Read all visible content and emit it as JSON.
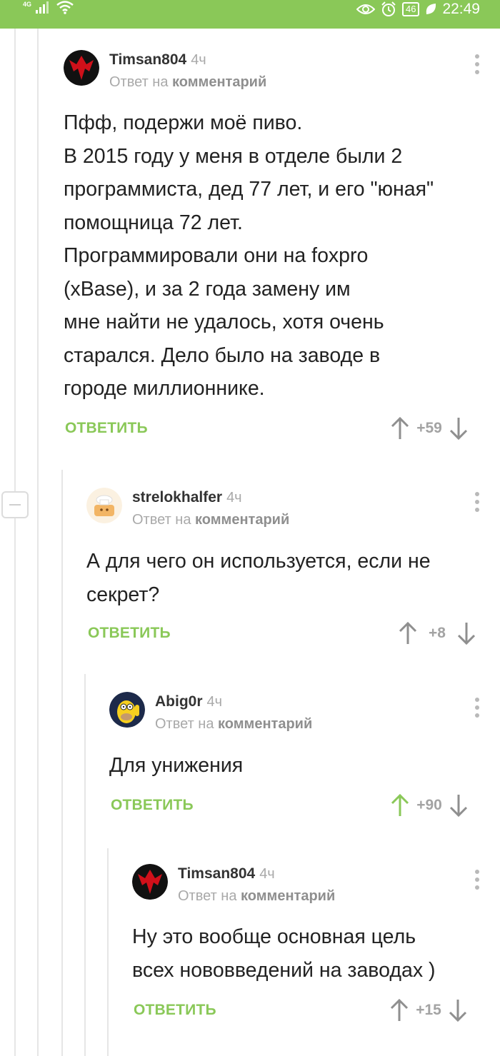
{
  "status_bar": {
    "network": "4G",
    "time": "22:49",
    "battery": "46",
    "icons": [
      "signal-icon",
      "wifi-icon",
      "eye-icon",
      "alarm-icon",
      "battery-icon",
      "leaf-icon"
    ]
  },
  "collapse_button": {
    "icon": "minus-icon"
  },
  "comments": [
    {
      "username": "Timsan804",
      "time": "4ч",
      "reply_prefix": "Ответ на",
      "reply_link": "комментарий",
      "text": "Пфф, подержи моё пиво.\nВ 2015 году у меня в отделе были 2\nпрограммиста, дед 77 лет, и его \"юная\"\nпомощница 72 лет.\nПрограммировали они на foxpro\n(xBase), и за 2 года замену им\nмне найти не удалось, хотя очень\nстарался. Дело было на заводе в\nгороде миллионнике.",
      "reply_label": "ОТВЕТИТЬ",
      "score": "+59",
      "upvoted": false
    },
    {
      "username": "strelokhalfer",
      "time": "4ч",
      "reply_prefix": "Ответ на",
      "reply_link": "комментарий",
      "text": "А для чего он используется, если не\nсекрет?",
      "reply_label": "ОТВЕТИТЬ",
      "score": "+8",
      "upvoted": false
    },
    {
      "username": "Abig0r",
      "time": "4ч",
      "reply_prefix": "Ответ на",
      "reply_link": "комментарий",
      "text": "Для унижения",
      "reply_label": "ОТВЕТИТЬ",
      "score": "+90",
      "upvoted": true
    },
    {
      "username": "Timsan804",
      "time": "4ч",
      "reply_prefix": "Ответ на",
      "reply_link": "комментарий",
      "text": "Ну это вообще основная цель\nвсех нововведений на заводах )",
      "reply_label": "ОТВЕТИТЬ",
      "score": "+15",
      "upvoted": false
    }
  ],
  "colors": {
    "accent": "#8ac858",
    "muted": "#a9a9a9",
    "text": "#222222"
  }
}
